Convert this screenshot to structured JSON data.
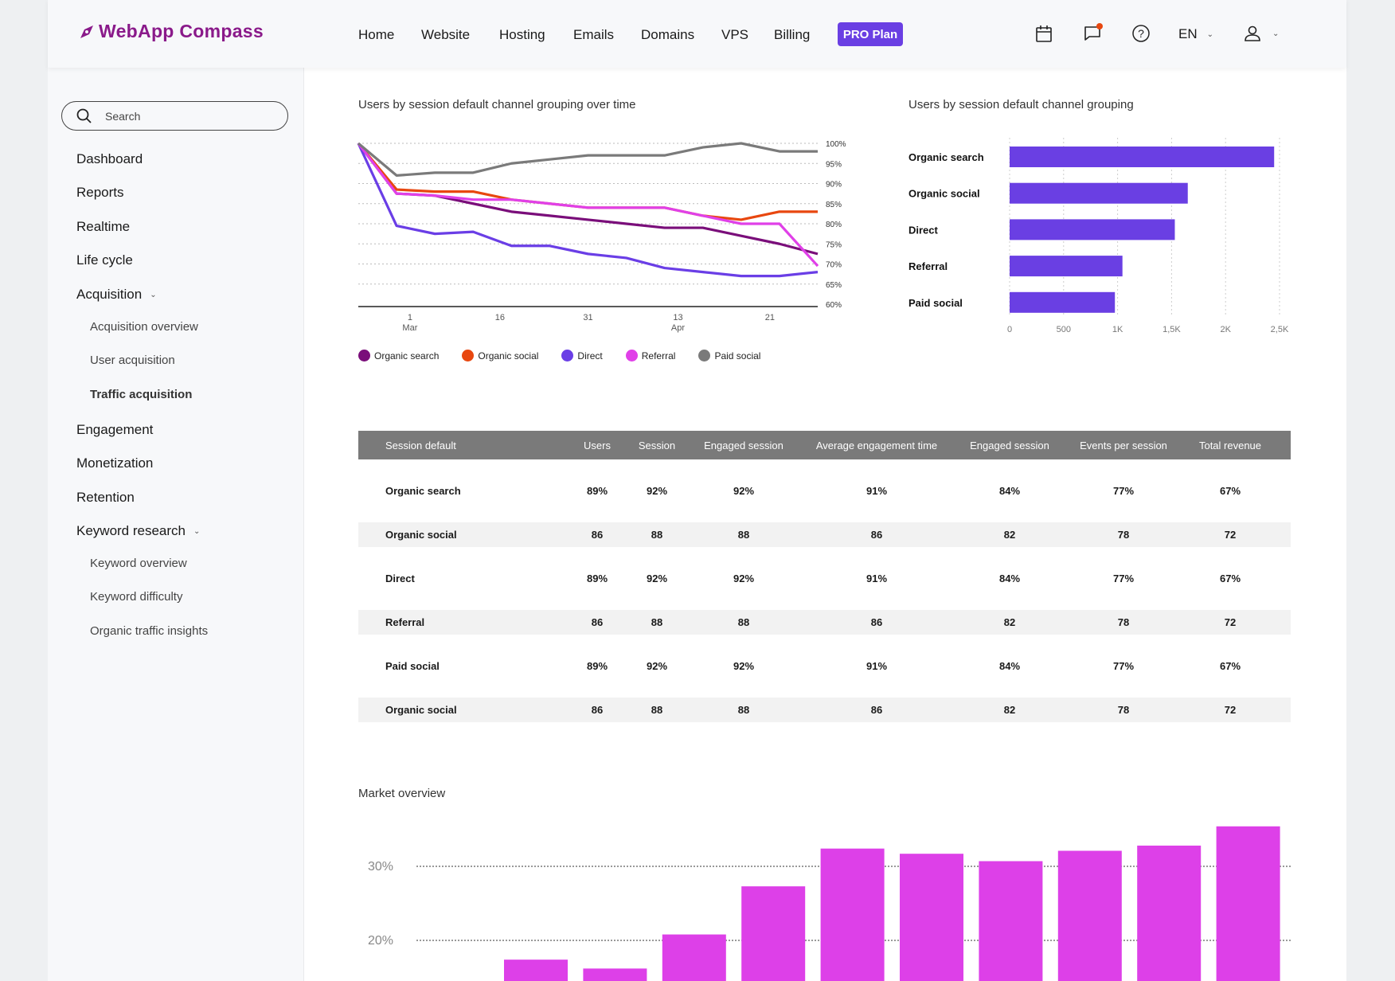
{
  "header": {
    "logo": "WebApp Compass",
    "nav": [
      "Home",
      "Website",
      "Hosting",
      "Emails",
      "Domains",
      "VPS",
      "Billing"
    ],
    "pro_label": "PRO Plan",
    "language": "EN",
    "icons": [
      "calendar-icon",
      "chat-icon",
      "help-icon",
      "user-icon"
    ],
    "notification_color": "#e8470f"
  },
  "sidebar": {
    "search_placeholder": "Search",
    "items": [
      {
        "label": "Dashboard"
      },
      {
        "label": "Reports"
      },
      {
        "label": "Realtime"
      },
      {
        "label": "Life cycle"
      },
      {
        "label": "Acquisition",
        "expanded": true,
        "children": [
          {
            "label": "Acquisition overview"
          },
          {
            "label": "User acquisition"
          },
          {
            "label": "Traffic acquisition",
            "active": true
          }
        ]
      },
      {
        "label": "Engagement"
      },
      {
        "label": "Monetization"
      },
      {
        "label": "Retention"
      },
      {
        "label": "Keyword research",
        "expanded": true,
        "children": [
          {
            "label": "Keyword overview"
          },
          {
            "label": "Keyword difficulty"
          },
          {
            "label": "Organic traffic insights"
          }
        ]
      }
    ]
  },
  "chart_data": [
    {
      "type": "line",
      "title": "Users by session default channel grouping over time",
      "x": [
        0,
        1,
        2,
        3,
        4,
        5,
        6,
        7,
        8,
        9,
        10,
        11,
        12
      ],
      "xticks": [
        {
          "at": 1.35,
          "label": "1",
          "sub": "Mar"
        },
        {
          "at": 3.7,
          "label": "16",
          "sub": ""
        },
        {
          "at": 6.0,
          "label": "31",
          "sub": ""
        },
        {
          "at": 8.35,
          "label": "13",
          "sub": "Apr"
        },
        {
          "at": 10.75,
          "label": "21",
          "sub": ""
        }
      ],
      "yticks": [
        "100%",
        "95%",
        "90%",
        "85%",
        "80%",
        "75%",
        "70%",
        "65%",
        "60%"
      ],
      "ylim": [
        60,
        100
      ],
      "grid": true,
      "legend": "bottom",
      "series": [
        {
          "name": "Organic search",
          "color": "#7a0e7a",
          "values": [
            100,
            87.5,
            87,
            85,
            83,
            82,
            81,
            80,
            79,
            79,
            77,
            75,
            72.5
          ]
        },
        {
          "name": "Organic social",
          "color": "#e8470f",
          "values": [
            100,
            88.5,
            88,
            88,
            86,
            85,
            84,
            84,
            84,
            82,
            81,
            83,
            83
          ]
        },
        {
          "name": "Direct",
          "color": "#6a3ee6",
          "values": [
            100,
            79.5,
            77.5,
            78,
            74.5,
            74.5,
            72.5,
            71.5,
            69,
            68,
            67,
            67,
            68
          ]
        },
        {
          "name": "Referral",
          "color": "#e040e8",
          "values": [
            100,
            87.5,
            87,
            86,
            86,
            85,
            84,
            84,
            84,
            82,
            80,
            80,
            69.5
          ]
        },
        {
          "name": "Paid social",
          "color": "#7a7a7a",
          "values": [
            100,
            92,
            92.7,
            92.7,
            95,
            96,
            97,
            97,
            97,
            99,
            100,
            98,
            98
          ]
        }
      ]
    },
    {
      "type": "bar",
      "orientation": "horizontal",
      "title": "Users by session default channel grouping",
      "categories": [
        "Organic search",
        "Organic social",
        "Direct",
        "Referral",
        "Paid social"
      ],
      "values": [
        2450,
        1650,
        1530,
        1045,
        975
      ],
      "xlim": [
        0,
        2500
      ],
      "xticks": [
        {
          "v": 0,
          "label": "0"
        },
        {
          "v": 500,
          "label": "500"
        },
        {
          "v": 1000,
          "label": "1K"
        },
        {
          "v": 1500,
          "label": "1,5K"
        },
        {
          "v": 2000,
          "label": "2K"
        },
        {
          "v": 2500,
          "label": "2,5K"
        }
      ],
      "color": "#6a3fe3",
      "grid": true
    },
    {
      "type": "bar",
      "title": "Market overview",
      "values": [
        17.4,
        16.2,
        20.8,
        27.3,
        32.4,
        31.7,
        30.7,
        32.1,
        32.8,
        35.4
      ],
      "yticks": [
        {
          "v": 30,
          "label": "30%"
        },
        {
          "v": 20,
          "label": "20%"
        }
      ],
      "color": "#dd40e8",
      "grid": true
    }
  ],
  "table": {
    "headers": [
      "Session default",
      "Users",
      "Session",
      "Engaged session",
      "Average engagement time",
      "Engaged session",
      "Events per session",
      "Total revenue"
    ],
    "rows": [
      [
        "Organic search",
        "89%",
        "92%",
        "92%",
        "91%",
        "84%",
        "77%",
        "67%"
      ],
      [
        "Organic social",
        "86",
        "88",
        "88",
        "86",
        "82",
        "78",
        "72"
      ],
      [
        "Direct",
        "89%",
        "92%",
        "92%",
        "91%",
        "84%",
        "77%",
        "67%"
      ],
      [
        "Referral",
        "86",
        "88",
        "88",
        "86",
        "82",
        "78",
        "72"
      ],
      [
        "Paid social",
        "89%",
        "92%",
        "92%",
        "91%",
        "84%",
        "77%",
        "67%"
      ],
      [
        "Organic social",
        "86",
        "88",
        "88",
        "86",
        "82",
        "78",
        "72"
      ]
    ]
  }
}
